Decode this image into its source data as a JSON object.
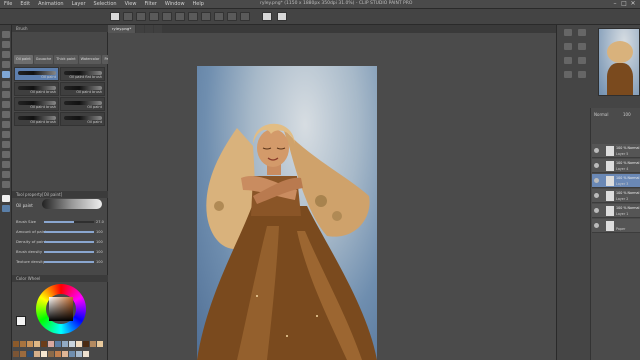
{
  "window": {
    "title": "-",
    "controls": [
      "–",
      "□",
      "✕"
    ]
  },
  "menu": {
    "items": [
      "File",
      "Edit",
      "Animation",
      "Layer",
      "Selection",
      "View",
      "Filter",
      "Window",
      "Help"
    ],
    "app_title": "ryley.png* (1150 x 1880px 350dpi 31.0%) - CLIP STUDIO PAINT PRO"
  },
  "doc_tabs": [
    "ryley.png*",
    "",
    "",
    ""
  ],
  "brush_panel": {
    "header": "Brush",
    "tabs": [
      "Oil paint",
      "Gouache",
      "Thick paint",
      "Watercolor",
      "Pastel"
    ],
    "items": [
      {
        "label": "Oil paint"
      },
      {
        "label": "Oil paint flat brush"
      },
      {
        "label": "Oil paint brush"
      },
      {
        "label": "Oil paint brush"
      },
      {
        "label": "Oil paint brush"
      },
      {
        "label": "Oil paint"
      },
      {
        "label": "Oil paint brush"
      },
      {
        "label": "Oil paint"
      }
    ]
  },
  "tool_property": {
    "header": "Tool property[Oil paint]",
    "brush_name": "Oil paint",
    "rows": [
      {
        "label": "Brush Size",
        "value": "27.0"
      },
      {
        "label": "Amount of paint",
        "value": "100"
      },
      {
        "label": "Density of paint",
        "value": "100"
      },
      {
        "label": "Brush density",
        "value": "100"
      },
      {
        "label": "Texture density",
        "value": "100"
      }
    ]
  },
  "color_panel": {
    "header": "Color Wheel"
  },
  "layer_panel": {
    "blend": "Normal",
    "opacity": "100",
    "layers": [
      {
        "name": "100 % Normal",
        "sub": "Layer 5"
      },
      {
        "name": "100 % Normal",
        "sub": "Layer 4"
      },
      {
        "name": "100 % Normal",
        "sub": "Layer 3"
      },
      {
        "name": "100 % Normal",
        "sub": "Layer 2"
      },
      {
        "name": "100 % Normal",
        "sub": "Layer 1"
      },
      {
        "name": "",
        "sub": "Paper"
      }
    ]
  },
  "colors": {
    "selection": "#6a88b5",
    "hair": "#d9b27c",
    "dress": "#7a4a1e",
    "background_blue": "#6f8eaf"
  }
}
